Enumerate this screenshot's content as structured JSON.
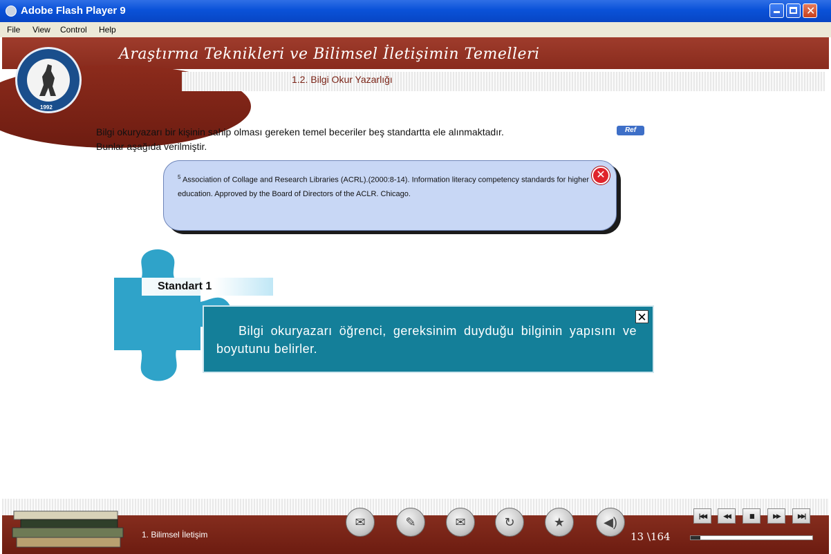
{
  "window": {
    "title": "Adobe Flash Player 9"
  },
  "menu": [
    "File",
    "View",
    "Control",
    "Help"
  ],
  "header": {
    "course_title": "Araştırma Teknikleri ve Bilimsel İletişimin Temelleri",
    "section_title": "1.2. Bilgi Okur Yazarlığı",
    "logo_year": "1992"
  },
  "content": {
    "intro_line1": "Bilgi okuryazarı bir kişinin sahip olması gereken temel beceriler beş standartta ele alınmaktadır.",
    "intro_line2": "Bunlar aşağıda verilmiştir.",
    "ref_badge": "Ref",
    "note_sup": "5",
    "note_text": "Association of Collage and Research Libraries (ACRL).(2000:8-14). Information literacy competency standards for higher education. Approved by the Board of Directors of the ACLR. Chicago.",
    "standard_title": "Standart 1",
    "standard_text": "Bilgi okuryazarı öğrenci, gereksinim duyduğu bilginin yapısını ve boyutunu belirler."
  },
  "footer": {
    "chapter_label": "1. Bilimsel İletişim",
    "tools": [
      "notes-icon",
      "edit-icon",
      "mail-icon",
      "refresh-icon",
      "star-icon",
      "speaker-icon"
    ],
    "media_buttons": [
      "first-page-icon",
      "previous-page-icon",
      "pause-icon",
      "next-page-icon",
      "last-page-icon"
    ],
    "current_page": "13",
    "total_pages": "\\164",
    "progress": 0.08
  },
  "colors": {
    "header_brown": "#7e2316",
    "standard_teal": "#147f99",
    "note_blue": "#c8d7f5",
    "close_red": "#e0242c"
  }
}
